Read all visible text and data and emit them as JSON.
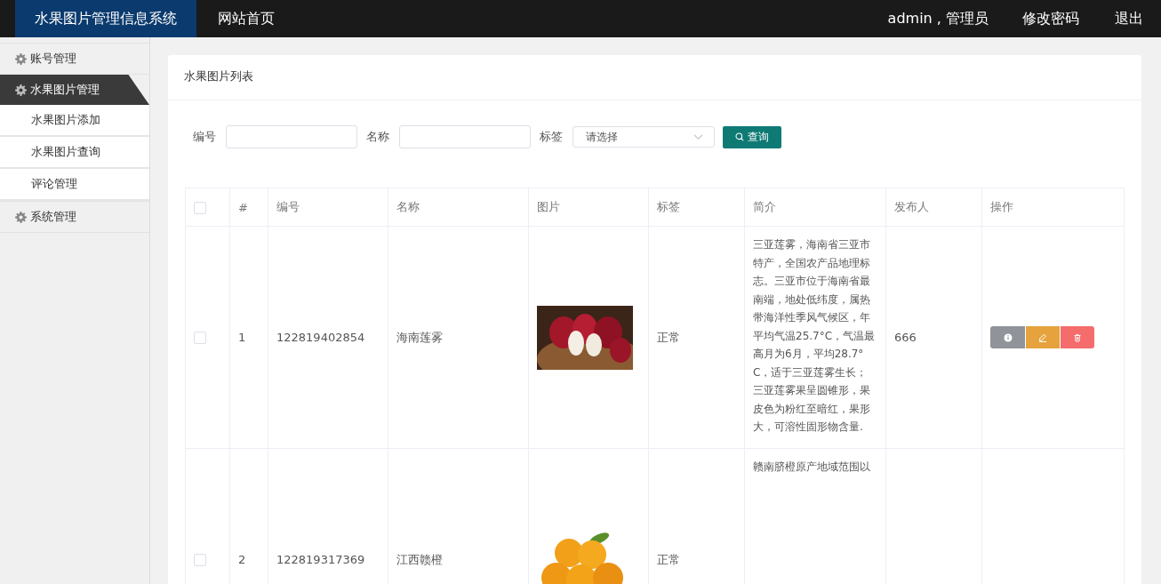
{
  "header": {
    "brand": "水果图片管理信息系统",
    "nav": [
      {
        "label": "网站首页"
      }
    ],
    "user": "admin , 管理员",
    "links": [
      {
        "label": "修改密码"
      },
      {
        "label": "退出"
      }
    ]
  },
  "sidebar": {
    "groups": [
      {
        "label": "账号管理",
        "expanded": false
      },
      {
        "label": "水果图片管理",
        "expanded": true,
        "children": [
          {
            "label": "水果图片添加"
          },
          {
            "label": "水果图片查询"
          },
          {
            "label": "评论管理"
          }
        ]
      },
      {
        "label": "系统管理",
        "expanded": false
      }
    ]
  },
  "panel": {
    "title": "水果图片列表",
    "filters": [
      {
        "kind": "text",
        "label": "编号"
      },
      {
        "kind": "text",
        "label": "名称"
      },
      {
        "kind": "select",
        "label": "标签",
        "placeholder": "请选择"
      }
    ],
    "search_button": "查询",
    "table": {
      "select_all_checked": false,
      "columns": [
        "#",
        "编号",
        "名称",
        "图片",
        "标签",
        "简介",
        "发布人",
        "操作"
      ],
      "rows": [
        {
          "checked": false,
          "index": "1",
          "code": "122819402854",
          "name": "海南莲雾",
          "tag": "正常",
          "summary": "三亚莲雾，海南省三亚市特产，全国农产品地理标志。三亚市位于海南省最南端，地处低纬度，属热带海洋性季风气候区，年平均气温25.7°C，气温最高月为6月，平均28.7°C，适于三亚莲雾生长；三亚莲雾果呈圆锥形，果皮色为粉红至暗红，果形大，可溶性固形物含量.",
          "publisher": "666",
          "actions": [
            {
              "kind": "info"
            },
            {
              "kind": "edit"
            },
            {
              "kind": "delete"
            }
          ]
        },
        {
          "checked": false,
          "index": "2",
          "code": "122819317369",
          "name": "江西赣橙",
          "tag": "正常",
          "summary": "赣南脐橙原产地域范围以"
        }
      ]
    }
  }
}
